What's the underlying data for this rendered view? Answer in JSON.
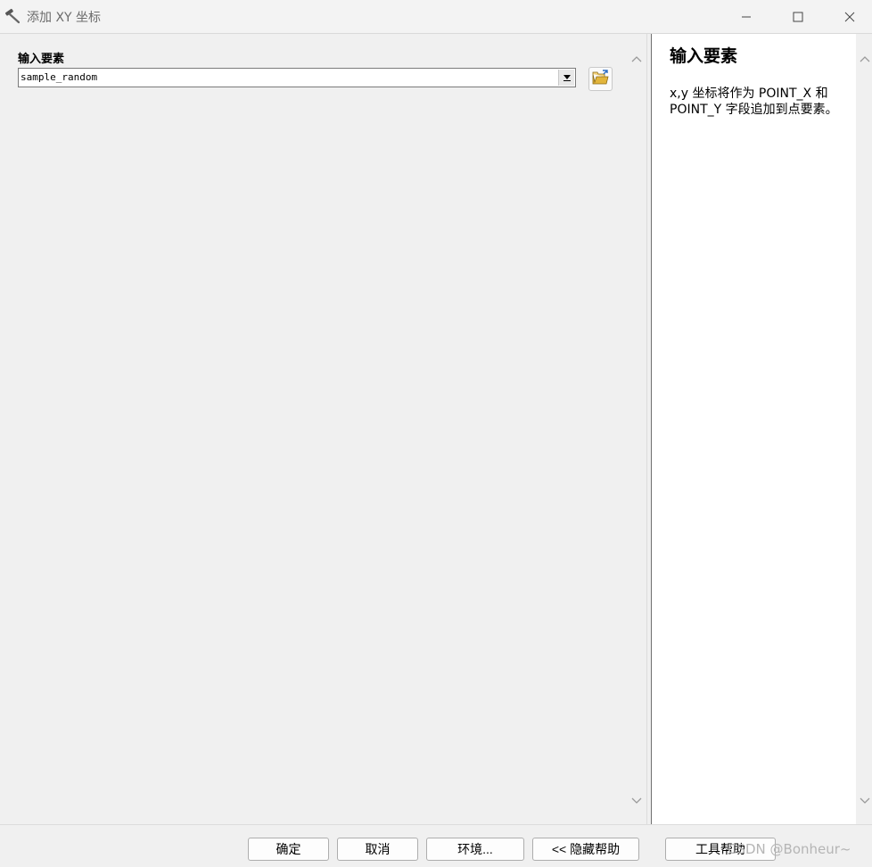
{
  "window": {
    "title": "添加 XY 坐标"
  },
  "form": {
    "input_label": "输入要素",
    "input_value": "sample_random"
  },
  "help": {
    "title": "输入要素",
    "body": "x,y 坐标将作为 POINT_X 和 POINT_Y 字段追加到点要素。"
  },
  "buttons": {
    "ok": "确定",
    "cancel": "取消",
    "environments": "环境...",
    "hide_help": "<< 隐藏帮助",
    "tool_help": "工具帮助"
  },
  "watermark": "CSDN @Bonheur~",
  "icons": {
    "title": "hammer-icon",
    "browse": "open-folder-icon",
    "dropdown": "dropdown-arrow-icon"
  }
}
